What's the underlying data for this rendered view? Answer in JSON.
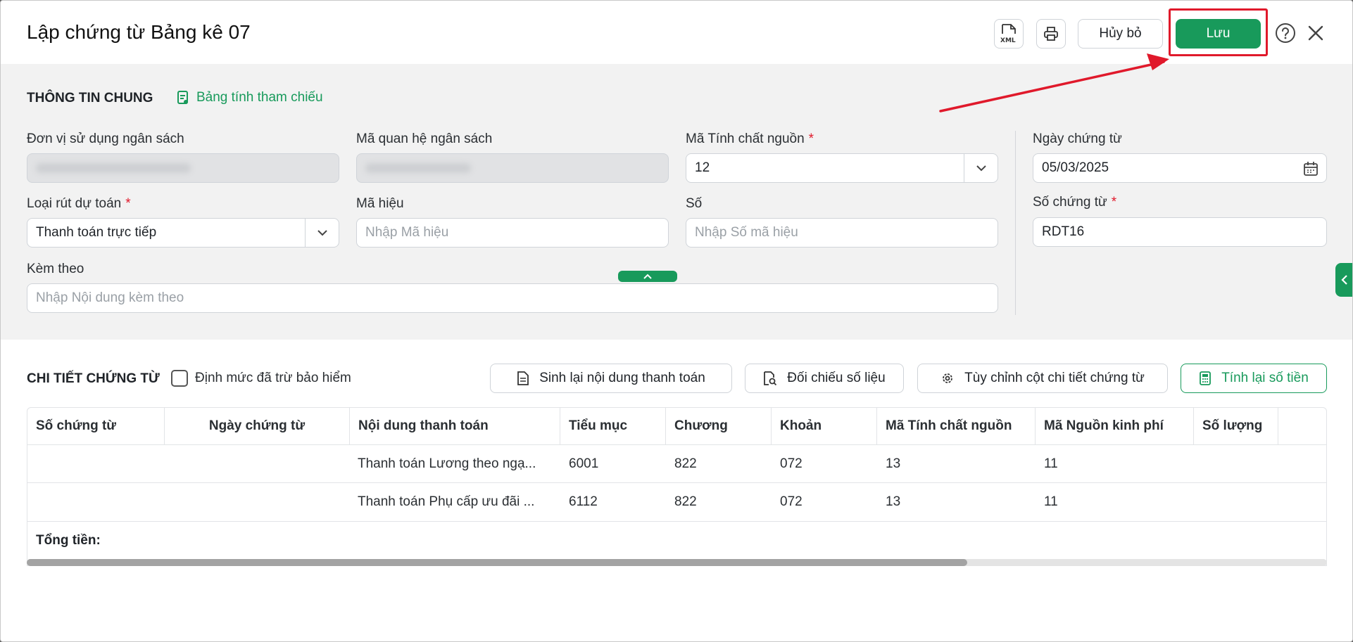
{
  "header": {
    "title": "Lập chứng từ Bảng kê 07",
    "xml_icon_label": "XML",
    "cancel_label": "Hủy bỏ",
    "save_label": "Lưu"
  },
  "info": {
    "section_title": "THÔNG TIN CHUNG",
    "ref_link": "Bảng tính tham chiếu",
    "fields": {
      "don_vi": {
        "label": "Đơn vị sử dụng ngân sách"
      },
      "ma_quan_he": {
        "label": "Mã quan hệ ngân sách"
      },
      "ma_tinh_chat": {
        "label": "Mã Tính chất nguồn",
        "required": "*",
        "value": "12"
      },
      "ngay_chung_tu": {
        "label": "Ngày chứng từ",
        "value": "05/03/2025"
      },
      "loai_rut": {
        "label": "Loại rút dự toán",
        "required": "*",
        "value": "Thanh toán trực tiếp"
      },
      "ma_hieu": {
        "label": "Mã hiệu",
        "placeholder": "Nhập Mã hiệu"
      },
      "so": {
        "label": "Số",
        "placeholder": "Nhập Số mã hiệu"
      },
      "so_chung_tu": {
        "label": "Số chứng từ",
        "required": "*",
        "value": "RDT16"
      },
      "kem_theo": {
        "label": "Kèm theo",
        "placeholder": "Nhập Nội dung kèm theo"
      }
    }
  },
  "detail": {
    "section_title": "CHI TIẾT CHỨNG TỪ",
    "checkbox_label": "Định mức đã trừ bảo hiểm",
    "buttons": {
      "regen": "Sinh lại nội dung thanh toán",
      "compare": "Đối chiếu số liệu",
      "customize": "Tùy chỉnh cột chi tiết chứng từ",
      "recalc": "Tính lại số tiền"
    },
    "table": {
      "columns": [
        "Số chứng từ",
        "Ngày chứng từ",
        "Nội dung thanh toán",
        "Tiểu mục",
        "Chương",
        "Khoản",
        "Mã Tính chất nguồn",
        "Mã Nguồn kinh phí",
        "Số lượng"
      ],
      "rows": [
        [
          "",
          "",
          "Thanh toán Lương theo ngạ...",
          "6001",
          "822",
          "072",
          "13",
          "11",
          ""
        ],
        [
          "",
          "",
          "Thanh toán Phụ cấp ưu đãi ...",
          "6112",
          "822",
          "072",
          "13",
          "11",
          ""
        ]
      ],
      "total_label": "Tổng tiền:"
    }
  },
  "colors": {
    "accent": "#189a5b",
    "highlight": "#e0192b"
  }
}
